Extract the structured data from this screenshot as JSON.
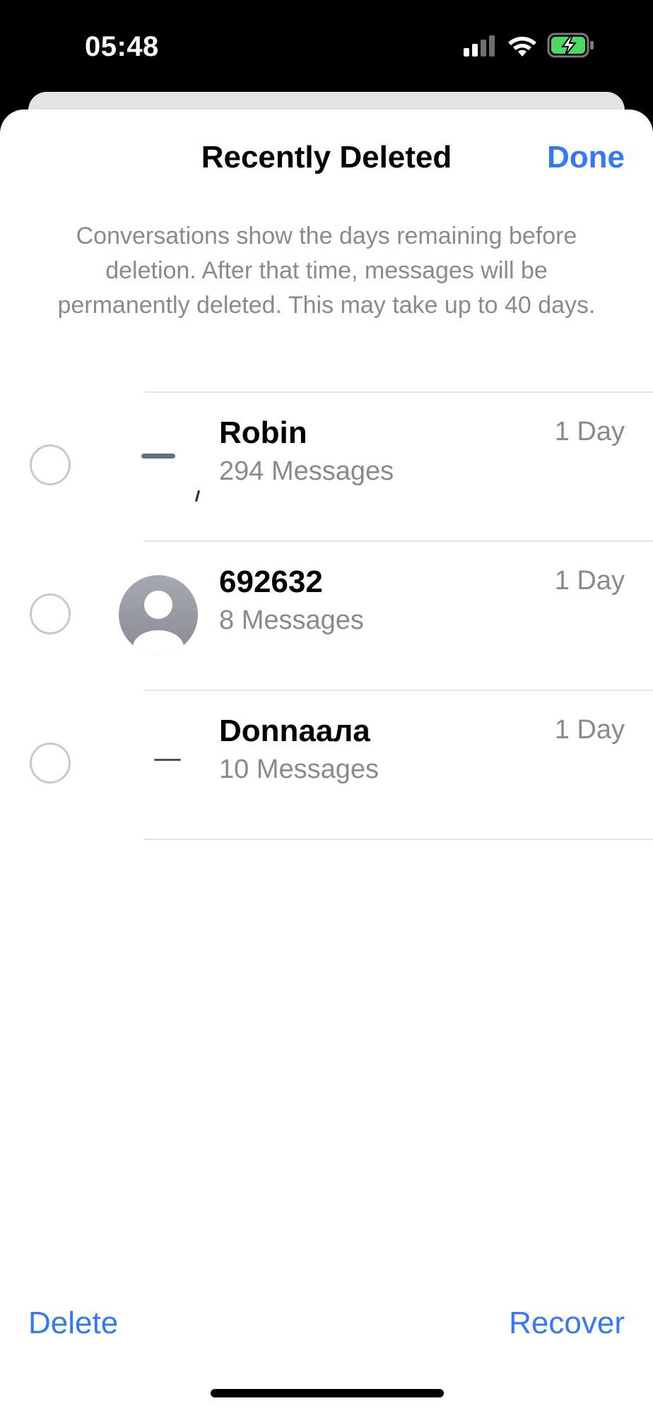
{
  "status_bar": {
    "time": "05:48",
    "icons": [
      "cellular-signal-icon",
      "wifi-icon",
      "battery-charging-icon"
    ]
  },
  "header": {
    "title": "Recently Deleted",
    "done_label": "Done"
  },
  "description": "Conversations show the days remaining before deletion. After that time, messages will be permanently deleted. This may take up to 40 days.",
  "conversations": [
    {
      "name": "Robin",
      "count": "294 Messages",
      "remaining": "1 Day",
      "avatar": "blank"
    },
    {
      "name": "692632",
      "count": "8 Messages",
      "remaining": "1 Day",
      "avatar": "person-placeholder-icon"
    },
    {
      "name": "Donnaала",
      "count": "10 Messages",
      "remaining": "1 Day",
      "avatar": "blank"
    }
  ],
  "toolbar": {
    "delete_label": "Delete",
    "recover_label": "Recover"
  },
  "colors": {
    "accent": "#3478f6",
    "secondary_text": "#8a8a8e",
    "separator": "#e4e4e8",
    "avatar_gray": "#9a9ba3",
    "battery_green": "#4cd964"
  }
}
